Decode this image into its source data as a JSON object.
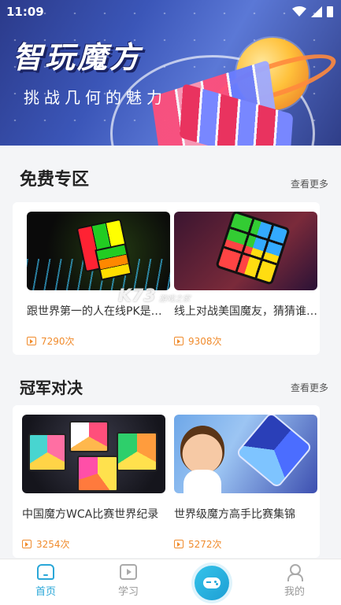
{
  "status_bar": {
    "time": "11:09"
  },
  "banner": {
    "title": "智玩魔方",
    "subtitle": "挑战几何的魅力"
  },
  "sections": [
    {
      "title": "免费专区",
      "more_label": "查看更多",
      "items": [
        {
          "title": "跟世界第一的人在线PK是什么体验",
          "plays": "7290次"
        },
        {
          "title": "线上对战美国魔友，猜猜谁赢了",
          "plays": "9308次"
        }
      ]
    },
    {
      "title": "冠军对决",
      "more_label": "查看更多",
      "items": [
        {
          "title": "中国魔方WCA比赛世界纪录",
          "plays": "3254次"
        },
        {
          "title": "世界级魔方高手比赛集锦",
          "plays": "5272次"
        }
      ]
    }
  ],
  "watermark": {
    "logo": "K73",
    "text": "游戏之家"
  },
  "nav": {
    "home": "首页",
    "learn": "学习",
    "mine": "我的"
  },
  "colors": {
    "accent": "#2aa7d8",
    "plays": "#f08b2c"
  }
}
